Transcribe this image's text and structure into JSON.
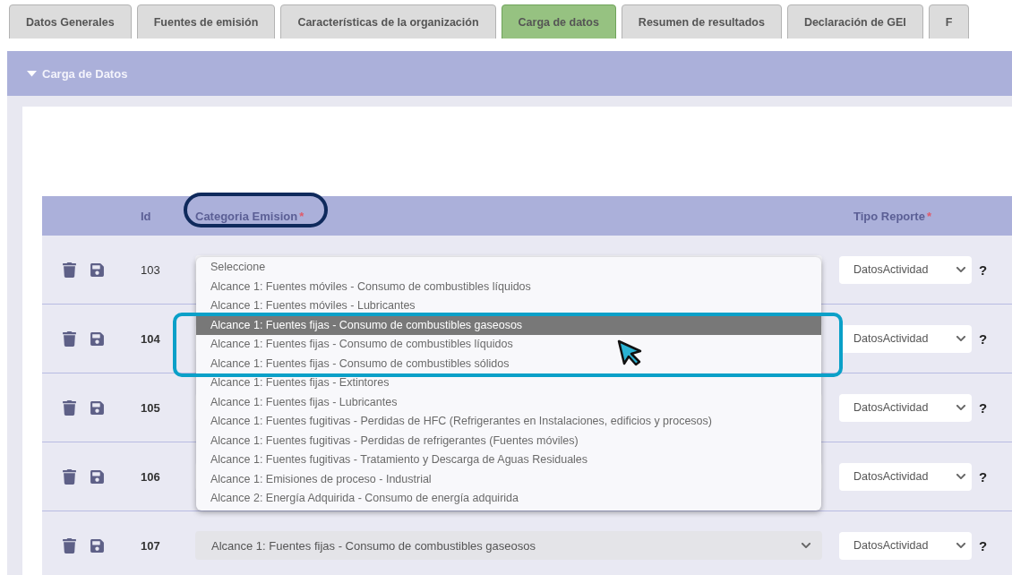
{
  "tabs": [
    {
      "label": "Datos Generales",
      "selected": false
    },
    {
      "label": "Fuentes de emisión",
      "selected": false
    },
    {
      "label": "Características de la organización",
      "selected": false
    },
    {
      "label": "Carga de datos",
      "selected": true
    },
    {
      "label": "Resumen de resultados",
      "selected": false
    },
    {
      "label": "Declaración de GEI",
      "selected": false
    },
    {
      "label": "F",
      "selected": false
    }
  ],
  "panel": {
    "title": "Carga de Datos",
    "expanded": true
  },
  "table": {
    "columns": [
      {
        "label": "Id"
      },
      {
        "label": "Categoria Emision",
        "required_mark": "*"
      },
      {
        "label": "Tipo Reporte",
        "required_mark": "*"
      }
    ],
    "rows": [
      {
        "id": "103",
        "emphasized": false,
        "category": {
          "open": true,
          "options": [
            {
              "label": "Seleccione",
              "selected": false
            },
            {
              "label": "Alcance 1: Fuentes móviles - Consumo de combustibles líquidos",
              "selected": false
            },
            {
              "label": "Alcance 1: Fuentes móviles - Lubricantes",
              "selected": false
            },
            {
              "label": "Alcance 1: Fuentes fijas - Consumo de combustibles gaseosos",
              "selected": true
            },
            {
              "label": "Alcance 1: Fuentes fijas - Consumo de combustibles líquidos",
              "selected": false
            },
            {
              "label": "Alcance 1: Fuentes fijas - Consumo de combustibles sólidos",
              "selected": false
            },
            {
              "label": "Alcance 1: Fuentes fijas - Extintores",
              "selected": false
            },
            {
              "label": "Alcance 1: Fuentes fijas - Lubricantes",
              "selected": false
            },
            {
              "label": "Alcance 1: Fuentes fugitivas - Perdidas de HFC (Refrigerantes en Instalaciones, edificios y procesos)",
              "selected": false
            },
            {
              "label": "Alcance 1: Fuentes fugitivas - Perdidas de refrigerantes (Fuentes móviles)",
              "selected": false
            },
            {
              "label": "Alcance 1: Fuentes fugitivas - Tratamiento y Descarga de Aguas Residuales",
              "selected": false
            },
            {
              "label": "Alcance 1: Emisiones de proceso - Industrial",
              "selected": false
            },
            {
              "label": "Alcance 2: Energía Adquirida - Consumo de energía adquirida",
              "selected": false
            }
          ]
        },
        "report_type": "DatosActividad",
        "help": "?"
      },
      {
        "id": "104",
        "emphasized": true,
        "category": {
          "open": false
        },
        "report_type": "DatosActividad",
        "help": "?"
      },
      {
        "id": "105",
        "emphasized": true,
        "category": {
          "open": false
        },
        "report_type": "DatosActividad",
        "help": "?"
      },
      {
        "id": "106",
        "emphasized": true,
        "category": {
          "open": false
        },
        "report_type": "DatosActividad",
        "help": "?"
      },
      {
        "id": "107",
        "emphasized": true,
        "category": {
          "open": false,
          "value": "Alcance 1: Fuentes fijas - Consumo de combustibles gaseosos"
        },
        "report_type": "DatosActividad",
        "help": "?"
      }
    ]
  }
}
